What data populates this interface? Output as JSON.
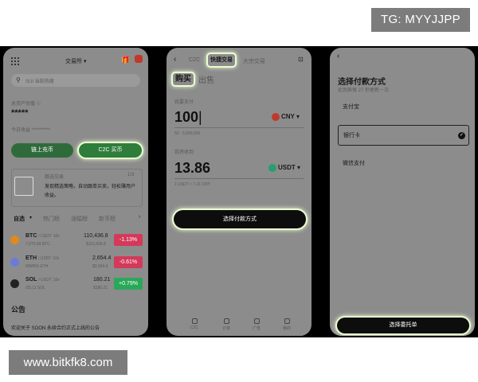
{
  "overlay": {
    "tg_label": "TG: MYYJJPP",
    "site_label": "www.bitkfk8.com"
  },
  "phone1": {
    "exchange_label": "交易所",
    "search_placeholder": "SUI 当前热搜",
    "asset_label": "总资产估值 ☉",
    "asset_value": "*****",
    "today_label": "今日收益 **********",
    "chain_button": "链上充币",
    "c2c_buy_button": "C2C 买币",
    "promo_title": "跟选交易",
    "promo_count": "1/3",
    "promo_text_line1": "发现精选策略，自动跟单买卖，轻松赚用户",
    "promo_text_line2": "收益。",
    "tabs": [
      "自选",
      "热门榜",
      "涨幅榜",
      "新币榜"
    ],
    "coins": [
      {
        "symbol": "BTC",
        "pair": "/ USDT",
        "badge": "10x",
        "sub": "7,075.69 BTC",
        "price": "110,436.8",
        "sub_price": "$110,436.8",
        "change": "-1.13%",
        "color": "#d33a5a"
      },
      {
        "symbol": "ETH",
        "pair": "/ USDT",
        "badge": "10x",
        "sub": "90M5% ETH",
        "price": "2,654.4",
        "sub_price": "$2,654.4",
        "change": "-0.61%",
        "color": "#d33a5a"
      },
      {
        "symbol": "SOL",
        "pair": "/ USDT",
        "badge": "10x",
        "sub": "/25.11 SOL",
        "price": "180.21",
        "sub_price": "$180.21",
        "change": "+0.79%",
        "color": "#2aa85a"
      }
    ],
    "announcement_title": "公告",
    "announcement_text": "欢迎关于 SOON 永续合约正式上线的公告"
  },
  "phone2": {
    "back_icon": "chevron-left-icon",
    "tab_c2c": "C2C",
    "tab_quick": "快捷交易",
    "tab_bulk": "大宗交易",
    "buy_label": "购买",
    "sell_label": "出售",
    "pay_label": "我要支付",
    "pay_amount": "100",
    "pay_currency": "CNY",
    "pay_hint": "50 - 5,000,000",
    "receive_label": "我将收到",
    "receive_amount": "13.86",
    "receive_currency": "USDT",
    "rate_hint": "1 USDT ≈ 7.21 CNY",
    "select_payment_button": "选择付款方式",
    "nav": [
      "C2C",
      "订单",
      "广告",
      "我的"
    ]
  },
  "phone3": {
    "title": "选择付款方式",
    "subtitle": "此到表每 27 秒更新一次",
    "methods": [
      "支付宝",
      "银行卡",
      "微信支付"
    ],
    "selected_method_index": 1,
    "choose_order_button": "选择委托单"
  }
}
